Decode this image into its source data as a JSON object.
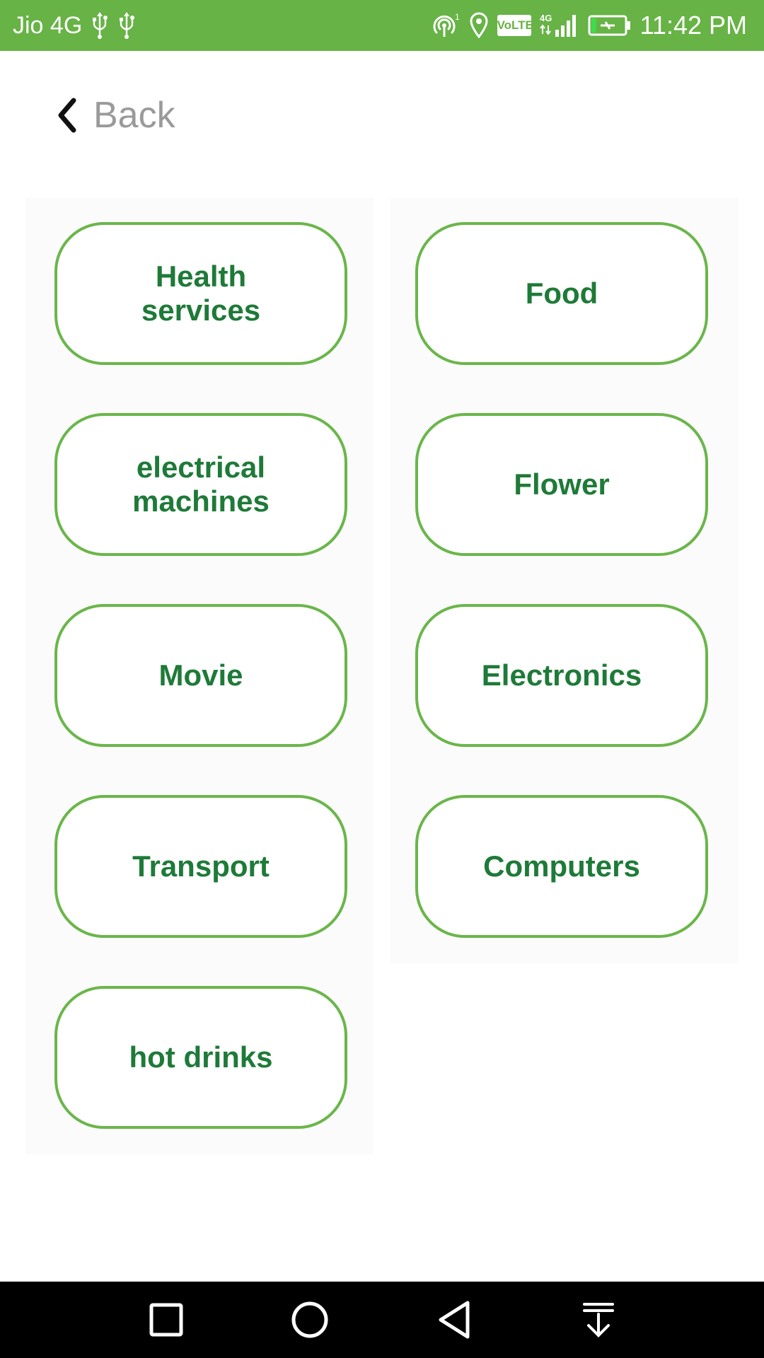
{
  "status_bar": {
    "carrier": "Jio 4G",
    "volte_label": "VoLTE",
    "time": "11:42 PM",
    "icons": [
      "usb-icon",
      "usb-icon",
      "hotspot-icon",
      "location-icon",
      "volte-icon",
      "signal-4g-icon",
      "battery-charging-icon"
    ]
  },
  "header": {
    "back_label": "Back",
    "back_icon": "chevron-left-icon"
  },
  "categories": [
    {
      "label": "Health\nservices"
    },
    {
      "label": "Food"
    },
    {
      "label": "electrical\nmachines"
    },
    {
      "label": "Flower"
    },
    {
      "label": "Movie"
    },
    {
      "label": "Electronics"
    },
    {
      "label": "Transport"
    },
    {
      "label": "Computers"
    },
    {
      "label": "hot drinks"
    }
  ],
  "nav_bar": {
    "buttons": [
      "recents-square-icon",
      "home-circle-icon",
      "back-triangle-icon",
      "notification-pull-icon"
    ]
  },
  "colors": {
    "status_bar": "#67b346",
    "button_border": "#6ab64a",
    "button_text": "#1e7a38",
    "back_text": "#9a9a9a",
    "nav_bar": "#000000"
  }
}
